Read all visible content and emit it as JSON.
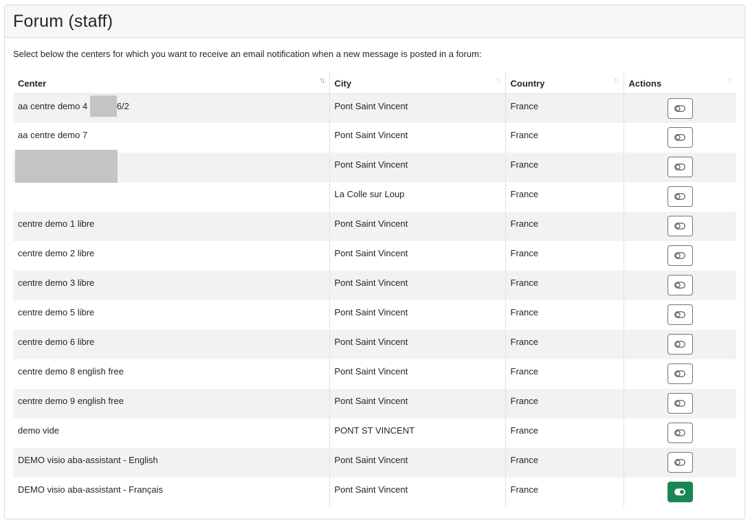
{
  "card": {
    "title": "Forum (staff)",
    "intro": "Select below the centers for which you want to receive an email notification when a new message is posted in a forum:"
  },
  "table": {
    "columns": [
      "Center",
      "City",
      "Country",
      "Actions"
    ],
    "rows": [
      {
        "center_before": "aa centre demo 4",
        "center_after": "6/2",
        "city": "Pont Saint Vincent",
        "country": "France",
        "subscribed": false
      },
      {
        "center": "aa centre demo 7",
        "city": "Pont Saint Vincent",
        "country": "France",
        "subscribed": false
      },
      {
        "center": "",
        "city": "Pont Saint Vincent",
        "country": "France",
        "subscribed": false
      },
      {
        "center": "",
        "city": "La Colle sur Loup",
        "country": "France",
        "subscribed": false
      },
      {
        "center": "centre demo 1 libre",
        "city": "Pont Saint Vincent",
        "country": "France",
        "subscribed": false
      },
      {
        "center": "centre demo 2 libre",
        "city": "Pont Saint Vincent",
        "country": "France",
        "subscribed": false
      },
      {
        "center": "centre demo 3 libre",
        "city": "Pont Saint Vincent",
        "country": "France",
        "subscribed": false
      },
      {
        "center": "centre demo 5 libre",
        "city": "Pont Saint Vincent",
        "country": "France",
        "subscribed": false
      },
      {
        "center": "centre demo 6 libre",
        "city": "Pont Saint Vincent",
        "country": "France",
        "subscribed": false
      },
      {
        "center": "centre demo 8 english free",
        "city": "Pont Saint Vincent",
        "country": "France",
        "subscribed": false
      },
      {
        "center": "centre demo 9 english free",
        "city": "Pont Saint Vincent",
        "country": "France",
        "subscribed": false
      },
      {
        "center": "demo vide",
        "city": "PONT ST VINCENT",
        "country": "France",
        "subscribed": false
      },
      {
        "center": "DEMO visio aba-assistant - English",
        "city": "Pont Saint Vincent",
        "country": "France",
        "subscribed": false
      },
      {
        "center": "DEMO visio aba-assistant - Français",
        "city": "Pont Saint Vincent",
        "country": "France",
        "subscribed": true
      }
    ]
  },
  "icons": {
    "sort": "sort-arrows-icon",
    "toggle_off": "toggle-off-icon",
    "toggle_on": "toggle-on-icon"
  },
  "colors": {
    "accent_on": "#198754",
    "stripe": "#f2f2f2",
    "header_bg": "#f7f7f7"
  }
}
